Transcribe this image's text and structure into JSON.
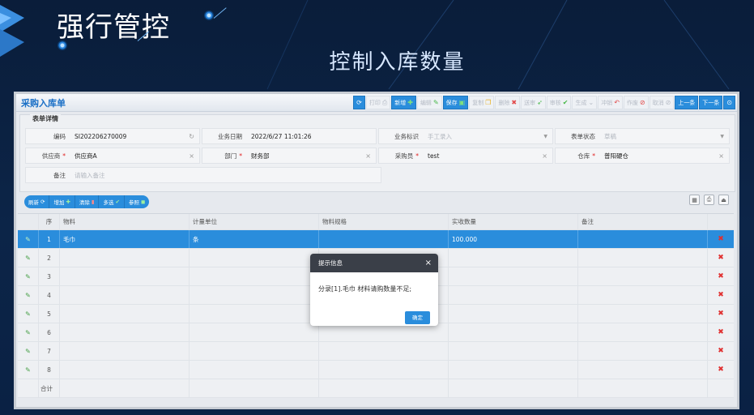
{
  "slide": {
    "title": "强行管控",
    "subtitle": "控制入库数量"
  },
  "app": {
    "title": "采购入库单",
    "toolbar": [
      {
        "label": "",
        "icon": "refresh-icon",
        "active": true
      },
      {
        "label": "打印",
        "icon": "print-icon",
        "active": false
      },
      {
        "label": "新增",
        "icon": "plus-icon",
        "active": true
      },
      {
        "label": "编辑",
        "icon": "edit-icon",
        "active": false
      },
      {
        "label": "保存",
        "icon": "save-icon",
        "active": true
      },
      {
        "label": "复制",
        "icon": "copy-icon",
        "active": false
      },
      {
        "label": "删除",
        "icon": "close-icon",
        "active": false
      },
      {
        "label": "送审",
        "icon": "send-icon",
        "active": false
      },
      {
        "label": "审核",
        "icon": "check-icon",
        "active": false
      },
      {
        "label": "生成",
        "icon": "chevron-down-icon",
        "active": false
      },
      {
        "label": "冲销",
        "icon": "undo-icon",
        "active": false
      },
      {
        "label": "作废",
        "icon": "ban-icon",
        "active": false
      },
      {
        "label": "取消",
        "icon": "cancel-icon",
        "active": false
      },
      {
        "label": "上一条",
        "icon": "",
        "active": true
      },
      {
        "label": "下一条",
        "icon": "",
        "active": true
      },
      {
        "label": "",
        "icon": "settings-icon",
        "active": true
      }
    ],
    "form": {
      "legend": "表单详情",
      "code_label": "编码",
      "code_value": "SI202206270009",
      "date_label": "业务日期",
      "date_value": "2022/6/27 11:01:26",
      "biz_label": "业务标识",
      "biz_value": "手工录入",
      "status_label": "表单状态",
      "status_value": "草稿",
      "supplier_label": "供应商",
      "supplier_value": "供应商A",
      "dept_label": "部门",
      "dept_value": "财务部",
      "buyer_label": "采购员",
      "buyer_value": "test",
      "warehouse_label": "仓库",
      "warehouse_value": "普阳硬仓",
      "remark_label": "备注",
      "remark_placeholder": "请输入备注"
    },
    "grid_toolbar": {
      "refresh": "刷新",
      "add": "增加",
      "remove": "清除",
      "multi": "多选",
      "ref": "参照"
    },
    "grid": {
      "headers": {
        "seq": "序",
        "material": "物料",
        "unit": "计量单位",
        "spec": "物料规格",
        "qty": "实收数量",
        "note": "备注"
      },
      "rows": [
        {
          "seq": "1",
          "material": "毛巾",
          "unit": "条",
          "spec": "",
          "qty": "100.000",
          "note": ""
        },
        {
          "seq": "2",
          "material": "",
          "unit": "",
          "spec": "",
          "qty": "",
          "note": ""
        },
        {
          "seq": "3",
          "material": "",
          "unit": "",
          "spec": "",
          "qty": "",
          "note": ""
        },
        {
          "seq": "4",
          "material": "",
          "unit": "",
          "spec": "",
          "qty": "",
          "note": ""
        },
        {
          "seq": "5",
          "material": "",
          "unit": "",
          "spec": "",
          "qty": "",
          "note": ""
        },
        {
          "seq": "6",
          "material": "",
          "unit": "",
          "spec": "",
          "qty": "",
          "note": ""
        },
        {
          "seq": "7",
          "material": "",
          "unit": "",
          "spec": "",
          "qty": "",
          "note": ""
        },
        {
          "seq": "8",
          "material": "",
          "unit": "",
          "spec": "",
          "qty": "",
          "note": ""
        }
      ],
      "total_label": "合计"
    },
    "dialog": {
      "title": "提示信息",
      "message": "分录[1].毛巾 材料请购数量不足;",
      "ok": "确定",
      "close": "×"
    }
  }
}
